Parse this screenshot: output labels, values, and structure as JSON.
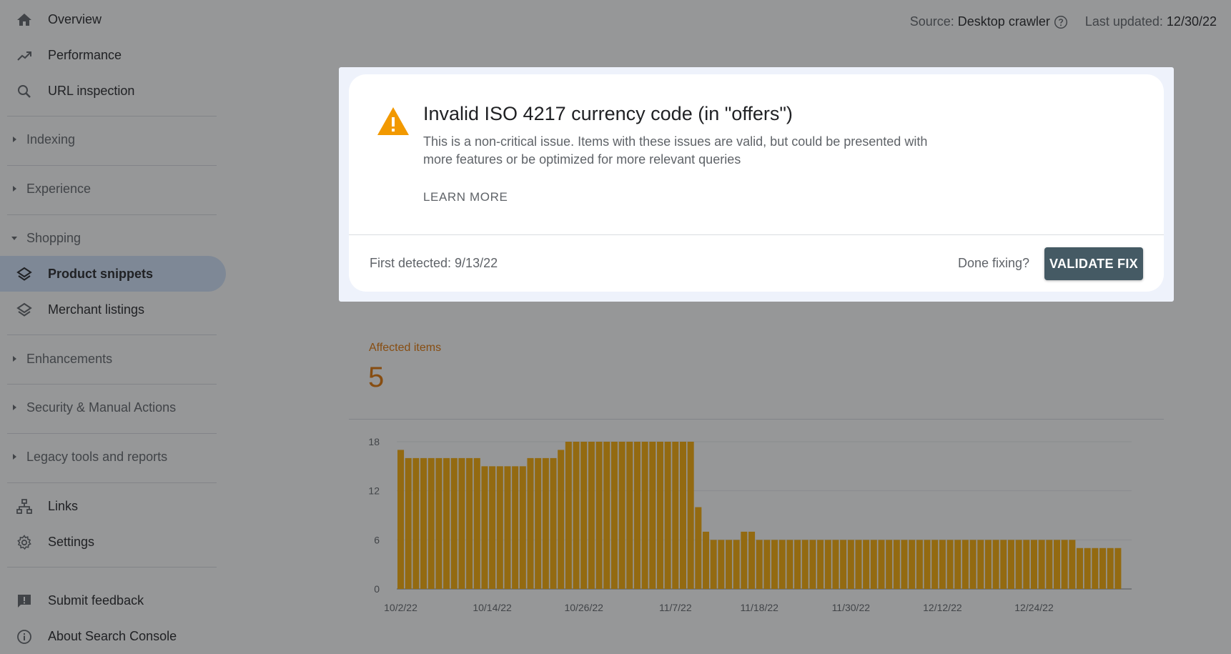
{
  "sidebar": {
    "top_items": [
      {
        "label": "Overview",
        "icon": "home-icon"
      },
      {
        "label": "Performance",
        "icon": "trending-up-icon"
      },
      {
        "label": "URL inspection",
        "icon": "search-icon"
      }
    ],
    "groups": {
      "indexing": "Indexing",
      "experience": "Experience",
      "shopping": "Shopping",
      "enhancements": "Enhancements",
      "security": "Security & Manual Actions",
      "legacy": "Legacy tools and reports"
    },
    "shopping_items": [
      {
        "label": "Product snippets",
        "icon": "layers-icon",
        "active": true
      },
      {
        "label": "Merchant listings",
        "icon": "layers-icon",
        "active": false
      }
    ],
    "bottom_items": [
      {
        "label": "Links",
        "icon": "sitemap-icon"
      },
      {
        "label": "Settings",
        "icon": "gear-icon"
      }
    ],
    "footer_items": [
      {
        "label": "Submit feedback",
        "icon": "feedback-icon"
      },
      {
        "label": "About Search Console",
        "icon": "info-icon"
      }
    ]
  },
  "topbar": {
    "source_label": "Source:",
    "source_value": "Desktop crawler",
    "updated_label": "Last updated:",
    "updated_value": "12/30/22"
  },
  "modal": {
    "title": "Invalid ISO 4217 currency code (in \"offers\")",
    "description": "This is a non-critical issue. Items with these issues are valid, but could be presented with more features or be optimized for more relevant queries",
    "learn_more": "LEARN MORE",
    "first_detected": "First detected: 9/13/22",
    "done_fixing": "Done fixing?",
    "validate_button": "VALIDATE FIX",
    "icon": "warning-icon"
  },
  "affected": {
    "label": "Affected items",
    "value": "5"
  },
  "colors": {
    "accent_orange": "#e37400",
    "bar": "#f9ab00",
    "active_nav": "#d2e3fc",
    "validate_button": "#455a64"
  },
  "chart_data": {
    "type": "bar",
    "title": "",
    "xlabel": "",
    "ylabel": "",
    "ylim": [
      0,
      18
    ],
    "yticks": [
      0,
      6,
      12,
      18
    ],
    "x_tick_labels": [
      "10/2/22",
      "10/14/22",
      "10/26/22",
      "11/7/22",
      "11/18/22",
      "11/30/22",
      "12/12/22",
      "12/24/22"
    ],
    "grid": true,
    "values": [
      17,
      16,
      16,
      16,
      16,
      16,
      16,
      16,
      16,
      16,
      16,
      15,
      15,
      15,
      15,
      15,
      15,
      16,
      16,
      16,
      16,
      17,
      18,
      18,
      18,
      18,
      18,
      18,
      18,
      18,
      18,
      18,
      18,
      18,
      18,
      18,
      18,
      18,
      18,
      10,
      7,
      6,
      6,
      6,
      6,
      7,
      7,
      6,
      6,
      6,
      6,
      6,
      6,
      6,
      6,
      6,
      6,
      6,
      6,
      6,
      6,
      6,
      6,
      6,
      6,
      6,
      6,
      6,
      6,
      6,
      6,
      6,
      6,
      6,
      6,
      6,
      6,
      6,
      6,
      6,
      6,
      6,
      6,
      6,
      6,
      6,
      6,
      6,
      6,
      5,
      5,
      5,
      5,
      5,
      5
    ]
  }
}
